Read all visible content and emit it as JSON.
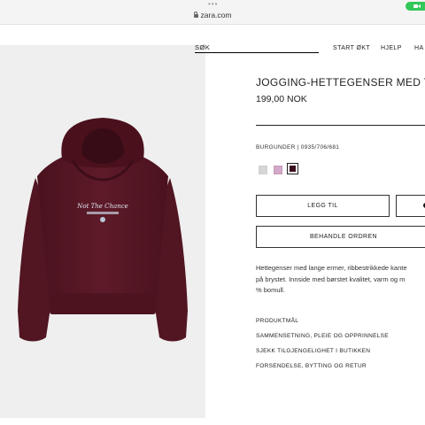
{
  "browser": {
    "url": "zara.com"
  },
  "header": {
    "search_label": "SØK",
    "nav": [
      "START ØKT",
      "HJELP",
      "HA"
    ]
  },
  "product": {
    "title": "JOGGING-HETTEGENSER MED TEK",
    "price": "199,00 NOK",
    "color_line": "BURGUNDER | 0935/706/681",
    "swatches": [
      {
        "name": "light-grey",
        "color": "#d6d6d6"
      },
      {
        "name": "pink",
        "color": "#d3a8c8"
      },
      {
        "name": "burgundy",
        "color": "#3b0f1e",
        "selected": true
      }
    ],
    "garment_color": "#5a1826",
    "print_text": "Not The Chance",
    "add_button": "LEGG TIL",
    "order_button": "BEHANDLE ORDREN",
    "description_lines": [
      "Hettegenser med lange ermer, ribbestrikkede kante",
      "på brystet. Innside med børstet kvalitet, varm og m",
      "% bomull."
    ],
    "links": [
      "PRODUKTMÅL",
      "SAMMENSETNING, PLEIE OG OPPRINNELSE",
      "SJEKK TILGJENGELIGHET I BUTIKKEN",
      "FORSENDELSE, BYTTING OG RETUR"
    ]
  }
}
